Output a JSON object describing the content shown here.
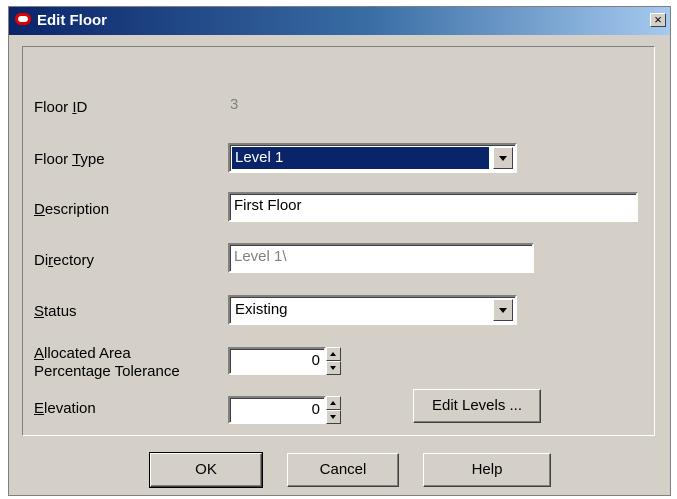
{
  "window": {
    "title": "Edit Floor",
    "close_glyph": "×"
  },
  "form": {
    "floor_id_label": "Floor ID",
    "floor_id_value": "3",
    "floor_type_label": "Floor Type",
    "floor_type_value": "Level 1",
    "description_label": "Description",
    "description_value": "First Floor",
    "directory_label": "Directory",
    "directory_value": "Level 1\\",
    "status_label": "Status",
    "status_value": "Existing",
    "allocated_label_line1": "Allocated Area",
    "allocated_label_line2": "Percentage Tolerance",
    "allocated_value": "0",
    "elevation_label": "Elevation",
    "elevation_value": "0",
    "edit_levels_label": "Edit Levels ..."
  },
  "buttons": {
    "ok": "OK",
    "cancel": "Cancel",
    "help": "Help"
  }
}
